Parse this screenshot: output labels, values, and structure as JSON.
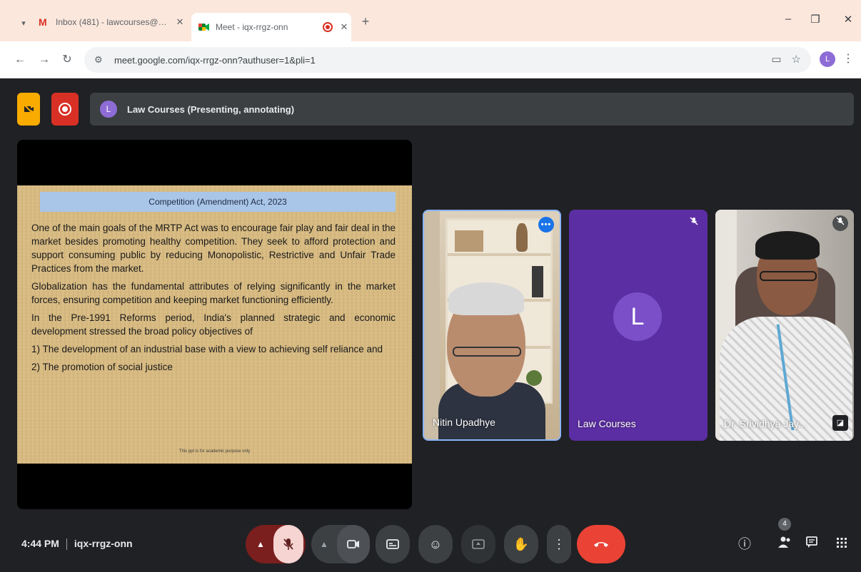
{
  "browser": {
    "tabs": [
      {
        "title": "Inbox (481) - lawcourses@gm",
        "icon": "gmail-icon",
        "active": false
      },
      {
        "title": "Meet - iqx-rrgz-onn",
        "icon": "meet-icon",
        "active": true
      }
    ],
    "url": "meet.google.com/iqx-rrgz-onn?authuser=1&pli=1",
    "profile_initial": "L"
  },
  "meet": {
    "presenter_initial": "L",
    "presenter_label": "Law Courses (Presenting, annotating)",
    "slide": {
      "title": "Competition (Amendment) Act, 2023",
      "paragraphs": [
        "One of the main goals of the MRTP Act was to encourage fair play and fair deal in the market besides promoting healthy competition. They seek to afford protection and support consuming public by reducing Monopolistic, Restrictive and Unfair Trade Practices from the market.",
        "Globalization has the fundamental attributes of relying significantly in the market forces, ensuring competition and keeping market functioning efficiently.",
        "In the Pre-1991 Reforms period, India's planned strategic and economic development stressed the broad policy objectives of"
      ],
      "list": [
        "1)  The development of an industrial base with a view to achieving self reliance and",
        "2)  The promotion of social justice"
      ],
      "footer": "This ppt is for academic purpose only"
    },
    "participants": [
      {
        "name": "Nitin Upadhye",
        "badge": "•••"
      },
      {
        "name": "Law Courses",
        "initial": "L",
        "badge": "mic-off"
      },
      {
        "name": "Dr. Srividhya Jay...",
        "badge": "mic-off"
      }
    ],
    "time": "4:44 PM",
    "meeting_code": "iqx-rrgz-onn",
    "people_count": "4",
    "colors": {
      "end_call": "#ea4335",
      "record": "#d93025",
      "accent": "#8ab4f8"
    }
  }
}
